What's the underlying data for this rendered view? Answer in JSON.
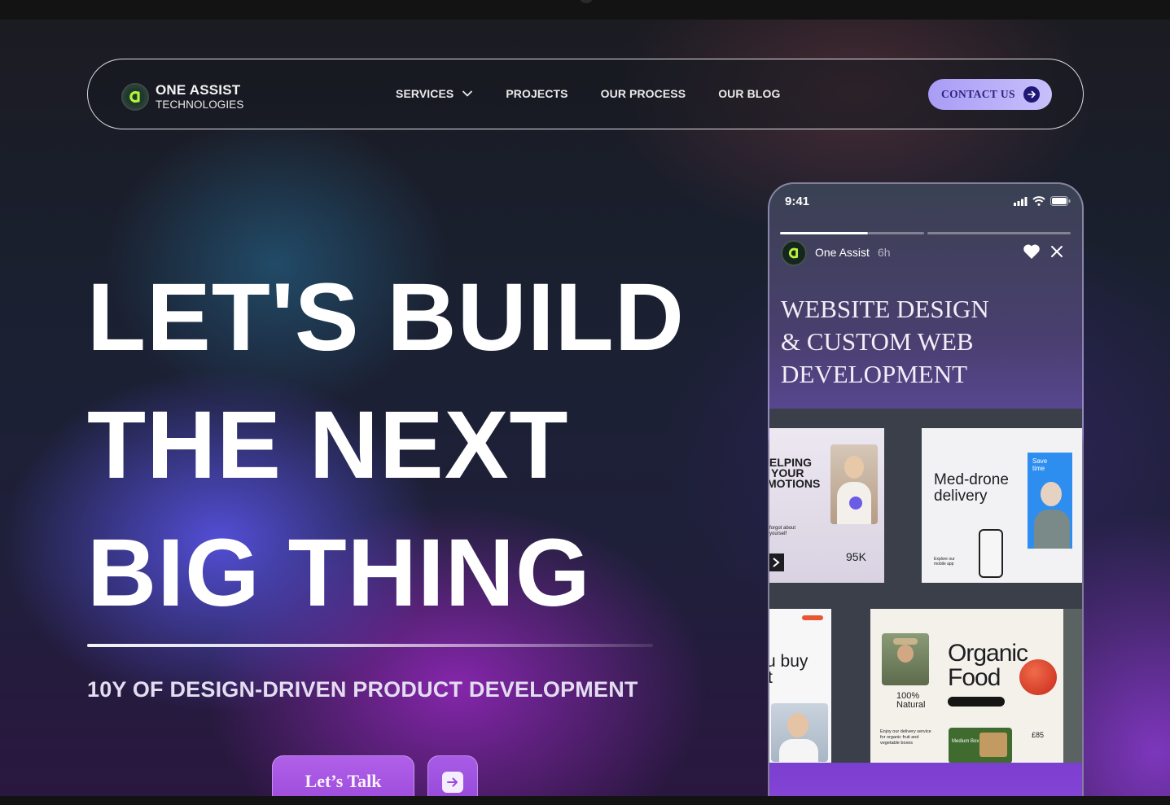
{
  "brand": {
    "name_line1": "ONE ASSIST",
    "name_line2": "TECHNOLOGIES"
  },
  "nav": {
    "items": [
      {
        "label": "SERVICES",
        "has_dropdown": true
      },
      {
        "label": "PROJECTS"
      },
      {
        "label": "OUR PROCESS"
      },
      {
        "label": "OUR BLOG"
      }
    ],
    "contact_label": "CONTACT US"
  },
  "hero": {
    "headline": [
      "LET'S BUILD",
      "THE NEXT",
      "BIG THING"
    ],
    "subtitle": "10Y OF DESIGN-DRIVEN PRODUCT DEVELOPMENT",
    "cta_label": "Let’s Talk"
  },
  "phone": {
    "time": "9:41",
    "story_user": "One Assist",
    "story_age": "6h",
    "story_title": [
      "WEBSITE DESIGN",
      "& CUSTOM WEB",
      "DEVELOPMENT"
    ],
    "cards": {
      "c1_text": [
        "IELPING",
        "YOUR",
        "MOTIONS"
      ],
      "c1_small": "forgot about",
      "c1_small2": "yourself",
      "c1_stat": "95K",
      "c2_text": [
        "Med-drone",
        "delivery"
      ],
      "c2_badge": "Save time",
      "c2_small": "Explore our mobile app",
      "c3_text": [
        "u buy",
        "t"
      ],
      "c4_text": [
        "Organic",
        "Food"
      ],
      "c4_badge": "100% Natural",
      "c4_small": "Enjoy our delivery service for organic fruit and vegetable boxes",
      "c4_price": "£85",
      "c4_box": "Medium Box"
    }
  },
  "colors": {
    "accent": "#a99cf6",
    "cta": "#a453e0",
    "dark_button": "#1f1775"
  }
}
